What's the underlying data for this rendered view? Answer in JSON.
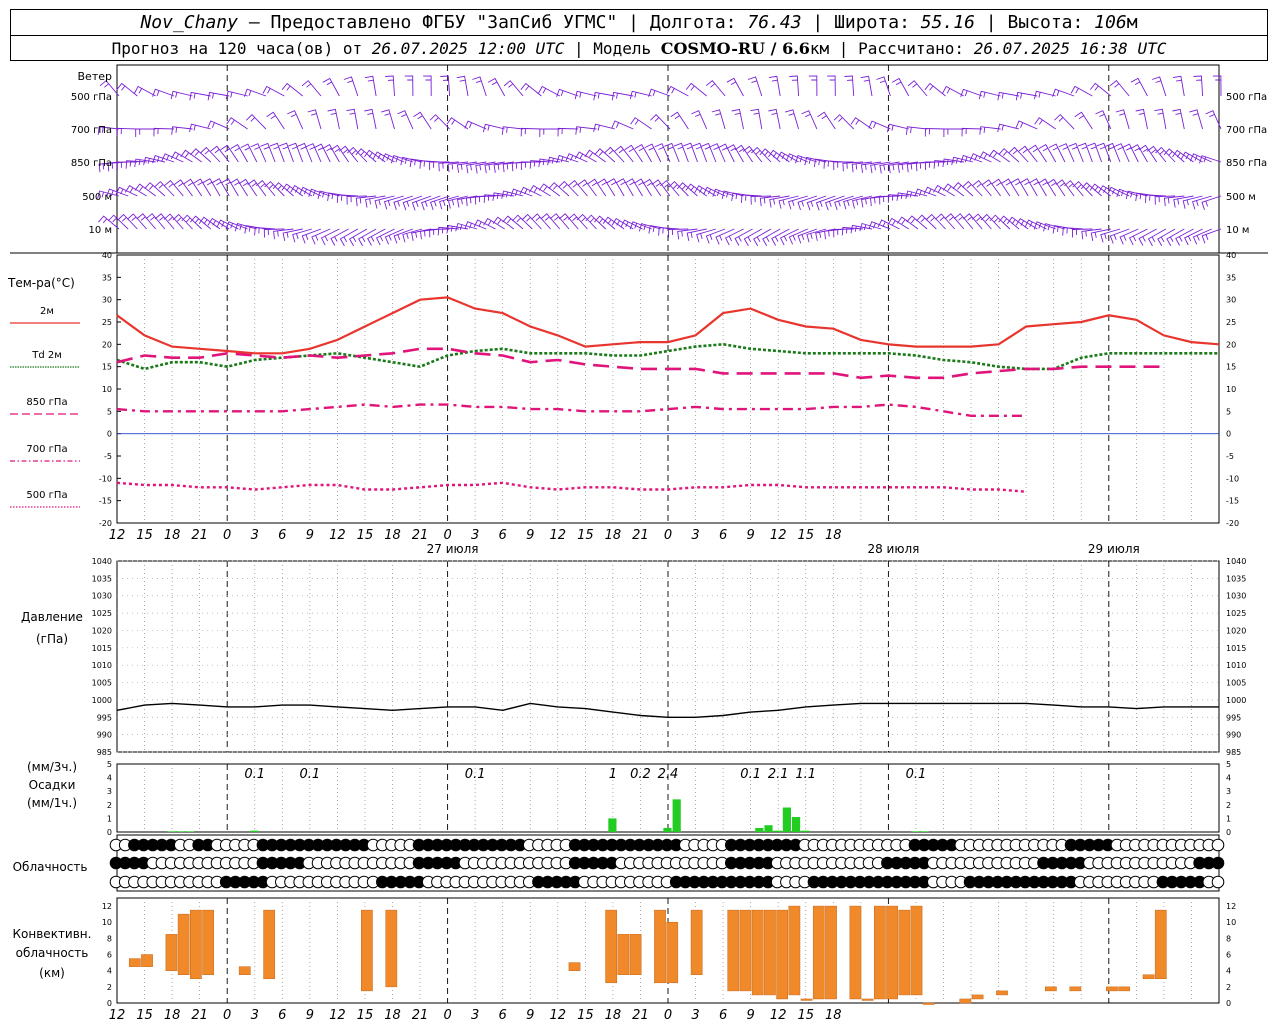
{
  "header": {
    "station": "Nov_Chany",
    "provider": "Предоставлено ФГБУ \"ЗапСиб УГМС\"",
    "lon_label": "Долгота:",
    "lon_value": "76.43",
    "lat_label": "Широта:",
    "lat_value": "55.16",
    "alt_label": "Высота:",
    "alt_value": "106",
    "alt_unit": "м",
    "forecast_text": "Прогноз на 120 часа(ов) от",
    "forecast_time": "26.07.2025 12:00 UTC",
    "model_label": "Модель",
    "model_name": "COSMO-RU / 6.6",
    "model_unit": "км",
    "calc_label": "Рассчитано:",
    "calc_time": "26.07.2025 16:38 UTC"
  },
  "time_axis": {
    "hour_labels": [
      "12",
      "15",
      "18",
      "21",
      "0",
      "3",
      "6",
      "9",
      "12",
      "15",
      "18",
      "21",
      "0",
      "3",
      "6",
      "9",
      "12",
      "15",
      "18",
      "21",
      "0",
      "3",
      "6",
      "9",
      "12",
      "15",
      "18"
    ],
    "date_labels": [
      "27 июля",
      "28 июля",
      "29 июля"
    ]
  },
  "wind": {
    "title": "Ветер",
    "levels": [
      "500 гПа",
      "700 гПа",
      "850 гПа",
      "500 м",
      "10 м"
    ],
    "color": "#7a1fd6"
  },
  "temperature": {
    "title": "Тем-ра(°C)",
    "legend": [
      {
        "label": "2м",
        "color": "#e8352e"
      },
      {
        "label": "Td 2м",
        "color": "#1a7a1a"
      },
      {
        "label": "850 гПа",
        "color": "#e0147a"
      },
      {
        "label": "700 гПа",
        "color": "#e0147a"
      },
      {
        "label": "500 гПа",
        "color": "#e0147a"
      }
    ],
    "y_ticks": [
      "40",
      "35",
      "30",
      "25",
      "20",
      "15",
      "10",
      "5",
      "0",
      "-5",
      "-10",
      "-15",
      "-20"
    ]
  },
  "pressure": {
    "title": "Давление",
    "unit": "(гПа)",
    "y_ticks": [
      "1040",
      "1035",
      "1030",
      "1025",
      "1020",
      "1015",
      "1010",
      "1005",
      "1000",
      "995",
      "990",
      "985"
    ]
  },
  "precip": {
    "unit_3h": "(мм/3ч.)",
    "title": "Осадки",
    "unit_1h": "(мм/1ч.)",
    "y_ticks": [
      "5",
      "4",
      "3",
      "2",
      "1",
      "0"
    ],
    "labels": [
      {
        "h": 15,
        "text": "0.1"
      },
      {
        "h": 21,
        "text": "0.1"
      },
      {
        "h": 39,
        "text": "0.1"
      },
      {
        "h": 54,
        "text": "1"
      },
      {
        "h": 57,
        "text": "0.2"
      },
      {
        "h": 60,
        "text": "2.4"
      },
      {
        "h": 69,
        "text": "0.1"
      },
      {
        "h": 72,
        "text": "2.1"
      },
      {
        "h": 75,
        "text": "1.1"
      },
      {
        "h": 87,
        "text": "0.1"
      }
    ],
    "color": "#22cc22"
  },
  "clouds": {
    "title": "Облачность"
  },
  "convective": {
    "title_line1": "Конвективн.",
    "title_line2": "облачность",
    "unit": "(км)",
    "y_ticks": [
      "12",
      "10",
      "8",
      "6",
      "4",
      "2",
      "0"
    ],
    "color": "#f0892a"
  },
  "chart_data": [
    {
      "type": "line",
      "title": "Тем-ра(°C)",
      "x": [
        0,
        3,
        6,
        9,
        12,
        15,
        18,
        21,
        24,
        27,
        30,
        33,
        36,
        39,
        42,
        45,
        48,
        51,
        54,
        57,
        60,
        63,
        66,
        69,
        72,
        75,
        78,
        81,
        84,
        87,
        90,
        93,
        96,
        99,
        102,
        105,
        108,
        111,
        114,
        117,
        120
      ],
      "ylim": [
        -20,
        40
      ],
      "series": [
        {
          "name": "2м",
          "values": [
            26.5,
            22,
            19.5,
            19,
            18.5,
            18,
            18,
            19,
            21,
            24,
            27,
            30,
            30.5,
            28,
            27,
            24,
            22,
            19.5,
            20,
            20.5,
            20.5,
            22,
            27,
            28,
            25.5,
            24,
            23.5,
            21,
            20,
            19.5,
            19.5,
            19.5,
            20,
            24,
            24.5,
            25,
            26.5,
            25.5,
            22,
            20.5,
            20
          ]
        },
        {
          "name": "Td 2м",
          "values": [
            16.5,
            14.5,
            16,
            16,
            15,
            16.5,
            17,
            17.5,
            18,
            17,
            16,
            15,
            17.5,
            18.5,
            19,
            18,
            18,
            18,
            17.5,
            17.5,
            18.5,
            19.5,
            20,
            19,
            18.5,
            18,
            18,
            18,
            18,
            17.5,
            16.5,
            16,
            15,
            14.5,
            14.5,
            17,
            18,
            18,
            18,
            18,
            18
          ]
        },
        {
          "name": "850 гПа",
          "values": [
            16,
            17.5,
            17,
            17,
            18,
            17.5,
            17,
            17.5,
            17,
            17.5,
            18,
            19,
            19,
            18,
            17.5,
            16,
            16.5,
            15.5,
            15,
            14.5,
            14.5,
            14.5,
            13.5,
            13.5,
            13.5,
            13.5,
            13.5,
            12.5,
            13,
            12.5,
            12.5,
            13.5,
            14,
            14.5,
            14.5,
            15,
            15,
            15,
            15
          ]
        },
        {
          "name": "700 гПа",
          "values": [
            5.5,
            5,
            5,
            5,
            5,
            5,
            5,
            5.5,
            6,
            6.5,
            6,
            6.5,
            6.5,
            6,
            6,
            5.5,
            5.5,
            5,
            5,
            5,
            5.5,
            6,
            5.5,
            5.5,
            5.5,
            5.5,
            6,
            6,
            6.5,
            6,
            5,
            4,
            4,
            4
          ]
        },
        {
          "name": "500 гПа",
          "values": [
            -11,
            -11.5,
            -11.5,
            -12,
            -12,
            -12.5,
            -12,
            -11.5,
            -11.5,
            -12.5,
            -12.5,
            -12,
            -11.5,
            -11.5,
            -11,
            -12,
            -12.5,
            -12,
            -12,
            -12.5,
            -12.5,
            -12,
            -12,
            -11.5,
            -11.5,
            -12,
            -12,
            -12,
            -12,
            -12,
            -12,
            -12.5,
            -12.5,
            -13
          ]
        }
      ]
    },
    {
      "type": "line",
      "title": "Давление",
      "x": [
        0,
        3,
        6,
        9,
        12,
        15,
        18,
        21,
        24,
        27,
        30,
        33,
        36,
        39,
        42,
        45,
        48,
        51,
        54,
        57,
        60,
        63,
        66,
        69,
        72,
        75,
        78,
        81,
        84,
        87,
        90,
        93,
        96,
        99,
        102,
        105,
        108,
        111,
        114,
        117,
        120
      ],
      "ylim": [
        985,
        1040
      ],
      "series": [
        {
          "name": "Давление",
          "values": [
            997,
            998.5,
            999,
            998.5,
            998,
            998,
            998.5,
            998.5,
            998,
            997.5,
            997,
            997.5,
            998,
            998,
            997,
            999,
            998,
            997.5,
            996.5,
            995.5,
            995,
            995,
            995.5,
            996.5,
            997,
            998,
            998.5,
            999,
            999,
            999,
            999,
            999,
            999,
            999,
            998.5,
            998,
            998,
            997.5,
            998,
            998,
            998
          ]
        }
      ]
    },
    {
      "type": "bar",
      "title": "Осадки",
      "x": [
        6,
        7,
        8,
        9,
        10,
        11,
        12,
        13,
        14,
        15,
        16,
        17,
        18,
        19,
        20,
        21,
        22,
        23,
        24,
        25,
        26,
        27,
        28,
        29,
        30,
        31,
        32,
        33,
        34,
        35,
        36,
        37,
        38,
        39,
        40,
        41,
        42,
        43,
        44,
        45,
        46,
        47,
        48,
        49,
        50,
        51,
        52,
        53,
        54,
        55,
        56,
        57,
        58,
        59,
        60,
        61,
        62,
        63,
        64,
        65,
        66,
        67,
        68,
        69,
        70,
        71,
        72,
        73,
        74,
        75,
        76,
        77,
        78,
        79,
        80,
        81,
        82,
        83,
        84,
        85,
        86,
        87,
        88,
        89,
        90
      ],
      "ylim": [
        0,
        5
      ],
      "series": [
        {
          "name": "мм/1ч.",
          "values": [
            0.05,
            0.05,
            0.05,
            0,
            0,
            0,
            0,
            0,
            0,
            0.1,
            0,
            0,
            0,
            0,
            0,
            0,
            0,
            0,
            0,
            0,
            0,
            0,
            0,
            0,
            0,
            0,
            0,
            0,
            0,
            0,
            0,
            0,
            0,
            0,
            0,
            0,
            0,
            0,
            0,
            0,
            0,
            0,
            0,
            0,
            0,
            0,
            0,
            0,
            1,
            0,
            0,
            0,
            0,
            0,
            0.3,
            2.4,
            0,
            0,
            0,
            0,
            0,
            0,
            0,
            0,
            0.3,
            0.5,
            0.1,
            1.8,
            1.1,
            0.1,
            0,
            0,
            0,
            0,
            0,
            0,
            0,
            0,
            0,
            0,
            0,
            0.05,
            0.05,
            0,
            0
          ]
        }
      ]
    },
    {
      "type": "bar",
      "title": "Конвективн. облачность",
      "ylim": [
        0,
        12
      ],
      "series": [
        {
          "name": "облачность (км)",
          "values": [
            [
              1,
              4.5,
              5.5
            ],
            [
              2,
              4.5,
              6
            ],
            [
              4,
              4,
              8.5
            ],
            [
              5,
              3.5,
              11
            ],
            [
              6,
              3,
              11.5
            ],
            [
              7,
              3.5,
              11.5
            ],
            [
              10,
              3.5,
              4.5
            ],
            [
              12,
              3,
              11.5
            ],
            [
              20,
              1.5,
              11.5
            ],
            [
              22,
              2,
              11.5
            ],
            [
              37,
              4,
              5
            ],
            [
              40,
              2.5,
              11.5
            ],
            [
              41,
              3.5,
              8.5
            ],
            [
              42,
              3.5,
              8.5
            ],
            [
              44,
              2.5,
              11.5
            ],
            [
              45,
              2.5,
              10
            ],
            [
              47,
              3.5,
              11.5
            ],
            [
              50,
              1.5,
              11.5
            ],
            [
              51,
              1.5,
              11.5
            ],
            [
              52,
              1,
              11.5
            ],
            [
              53,
              1,
              11.5
            ],
            [
              54,
              0.5,
              11.5
            ],
            [
              55,
              1,
              12
            ],
            [
              56,
              0.5,
              0.5
            ],
            [
              57,
              0.5,
              12
            ],
            [
              58,
              0.5,
              12
            ],
            [
              60,
              0.5,
              12
            ],
            [
              61,
              0.5,
              0.5
            ],
            [
              62,
              0.5,
              12
            ],
            [
              63,
              0.5,
              12
            ],
            [
              64,
              1,
              11.5
            ],
            [
              65,
              1,
              12
            ],
            [
              66,
              0,
              0
            ],
            [
              69,
              0,
              0.5
            ],
            [
              70,
              0.5,
              1
            ],
            [
              72,
              1,
              1.5
            ],
            [
              76,
              1.5,
              2
            ],
            [
              78,
              1.5,
              2
            ],
            [
              81,
              1.5,
              2
            ],
            [
              82,
              1.5,
              2
            ],
            [
              84,
              3,
              3.5
            ],
            [
              85,
              3,
              11.5
            ]
          ]
        }
      ]
    }
  ]
}
